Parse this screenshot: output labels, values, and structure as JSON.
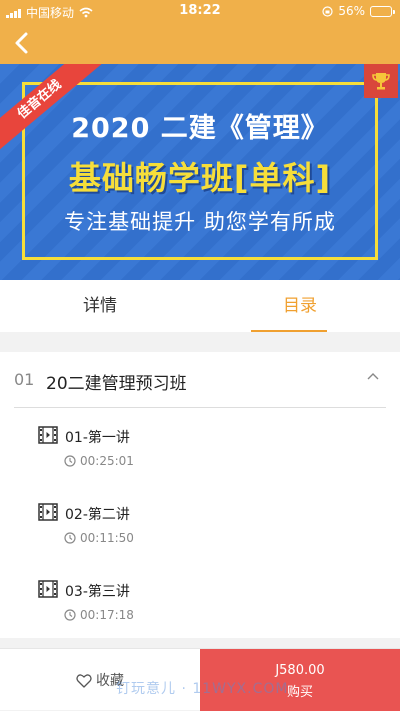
{
  "status_bar": {
    "carrier": "中国移动",
    "time": "18:22",
    "battery_percent": "56%",
    "battery_level": 0.56
  },
  "banner": {
    "ribbon": "佳音在线",
    "line1": "2020 二建《管理》",
    "line2": "基础畅学班[单科]",
    "line3": "专注基础提升 助您学有所成"
  },
  "tabs": [
    {
      "label": "详情",
      "active": false
    },
    {
      "label": "目录",
      "active": true
    }
  ],
  "catalog": {
    "section": {
      "number": "01",
      "title": "20二建管理预习班"
    },
    "lessons": [
      {
        "name": "01-第一讲",
        "duration": "00:25:01"
      },
      {
        "name": "02-第二讲",
        "duration": "00:11:50"
      },
      {
        "name": "03-第三讲",
        "duration": "00:17:18"
      }
    ]
  },
  "bottom_bar": {
    "favorite_label": "收藏",
    "price": "J580.00",
    "buy_label": "购买"
  },
  "watermark": "钉玩意儿 · 11WYX.COM",
  "colors": {
    "header": "#f0b04a",
    "accent": "#f0a030",
    "buy_button": "#e95452",
    "banner_blue": "#3a78d4",
    "banner_yellow": "#f6de3a"
  }
}
